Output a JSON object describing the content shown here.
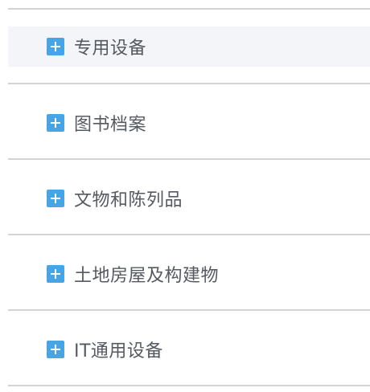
{
  "category_list": {
    "items": [
      {
        "label": "专用设备",
        "icon": "plus-expand-icon",
        "highlighted": true
      },
      {
        "label": "图书档案",
        "icon": "plus-expand-icon",
        "highlighted": false
      },
      {
        "label": "文物和陈列品",
        "icon": "plus-expand-icon",
        "highlighted": false
      },
      {
        "label": "土地房屋及构建物",
        "icon": "plus-expand-icon",
        "highlighted": false
      },
      {
        "label": "IT通用设备",
        "icon": "plus-expand-icon",
        "highlighted": false
      }
    ]
  },
  "colors": {
    "icon_background": "#47a5e5",
    "icon_glyph": "#ffffff",
    "row_highlight": "#f3f5f9",
    "divider": "#d3d3d3",
    "label_text": "#555a60"
  }
}
